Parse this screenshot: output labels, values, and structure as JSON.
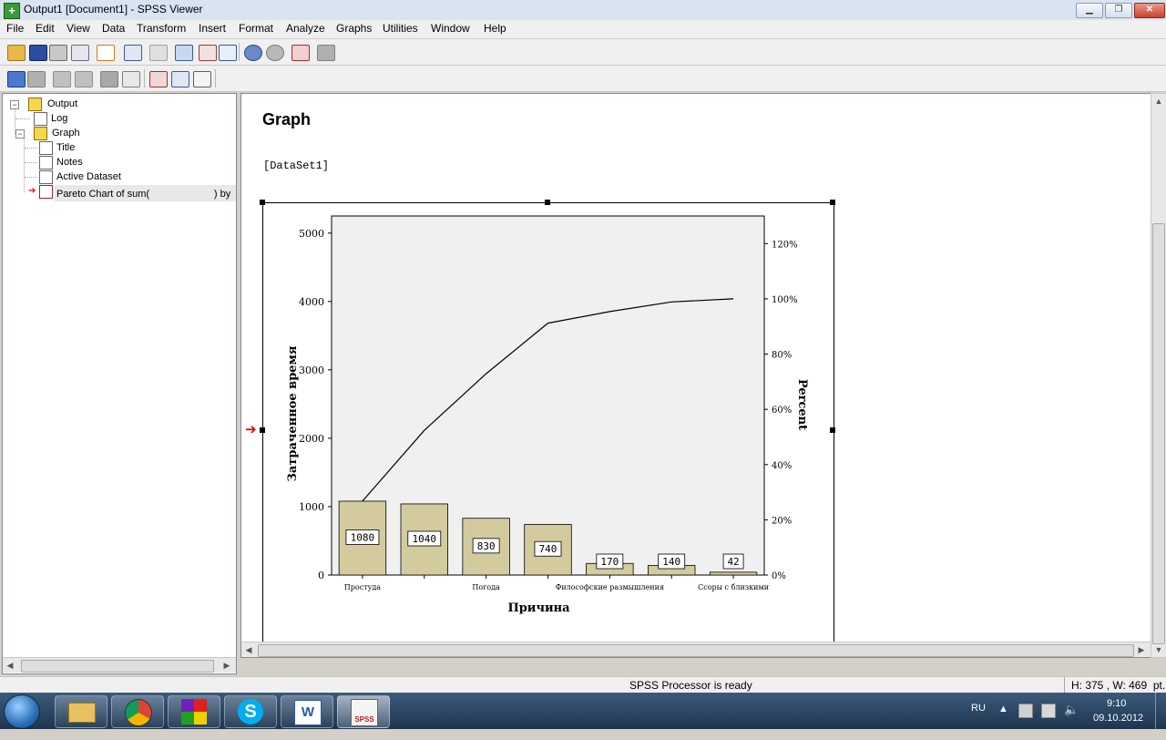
{
  "window": {
    "title": "Output1 [Document1] - SPSS Viewer",
    "icon": "spss-app-icon",
    "buttons": {
      "minimize": "▁",
      "restore": "❐",
      "close": "✕"
    }
  },
  "menu": [
    "File",
    "Edit",
    "View",
    "Data",
    "Transform",
    "Insert",
    "Format",
    "Analyze",
    "Graphs",
    "Utilities",
    "Window",
    "Help"
  ],
  "outline": {
    "items": [
      {
        "label": "Output",
        "icon": "output-book-icon",
        "level": 0,
        "toggle": "−"
      },
      {
        "label": "Log",
        "icon": "log-icon",
        "level": 1
      },
      {
        "label": "Graph",
        "icon": "graph-book-icon",
        "level": 1,
        "toggle": "−"
      },
      {
        "label": "Title",
        "icon": "title-icon",
        "level": 2
      },
      {
        "label": "Notes",
        "icon": "notes-icon",
        "level": 2
      },
      {
        "label": "Active Dataset",
        "icon": "dataset-icon",
        "level": 2
      },
      {
        "label": "Pareto Chart of sum(ᅟᅟᅟᅟᅟᅟᅟ) by ᅟᅟᅟ",
        "icon": "pareto-chart-icon",
        "level": 2,
        "selected": true
      }
    ]
  },
  "viewer": {
    "heading": "Graph",
    "dataset": "[DataSet1]"
  },
  "chart_data": {
    "type": "bar",
    "subtype": "pareto",
    "title": "",
    "xlabel": "Причина",
    "ylabel": "Затраченное время",
    "y2label": "Percent",
    "ylim": [
      0,
      5250
    ],
    "y_ticks": [
      0,
      1000,
      2000,
      3000,
      4000,
      5000
    ],
    "y2lim": [
      0,
      130
    ],
    "y2_ticks": [
      "0%",
      "20%",
      "40%",
      "60%",
      "80%",
      "100%",
      "120%"
    ],
    "categories": [
      "Простуда",
      "",
      "Погода",
      "",
      "Философские размышления",
      "",
      "Ссоры с близкими"
    ],
    "values": [
      1080,
      1040,
      830,
      740,
      170,
      140,
      42
    ],
    "value_labels": [
      "1080",
      "1040",
      "830",
      "740",
      "170",
      "140",
      "42"
    ],
    "cumulative_percent": [
      26.7,
      52.4,
      72.9,
      91.2,
      95.4,
      98.9,
      100
    ],
    "grid": false,
    "bar_color": "#d3cb9e",
    "plot_background": "#f0f0f0"
  },
  "status": {
    "message": "SPSS Processor is ready",
    "size": "H: 375 , W: 469  pt."
  },
  "taskbar": {
    "apps": [
      "explorer-icon",
      "chrome-icon",
      "colorful-app-icon",
      "skype-icon",
      "word-icon",
      "spss-icon"
    ],
    "language": "RU",
    "time": "9:10",
    "date": "09.10.2012"
  }
}
